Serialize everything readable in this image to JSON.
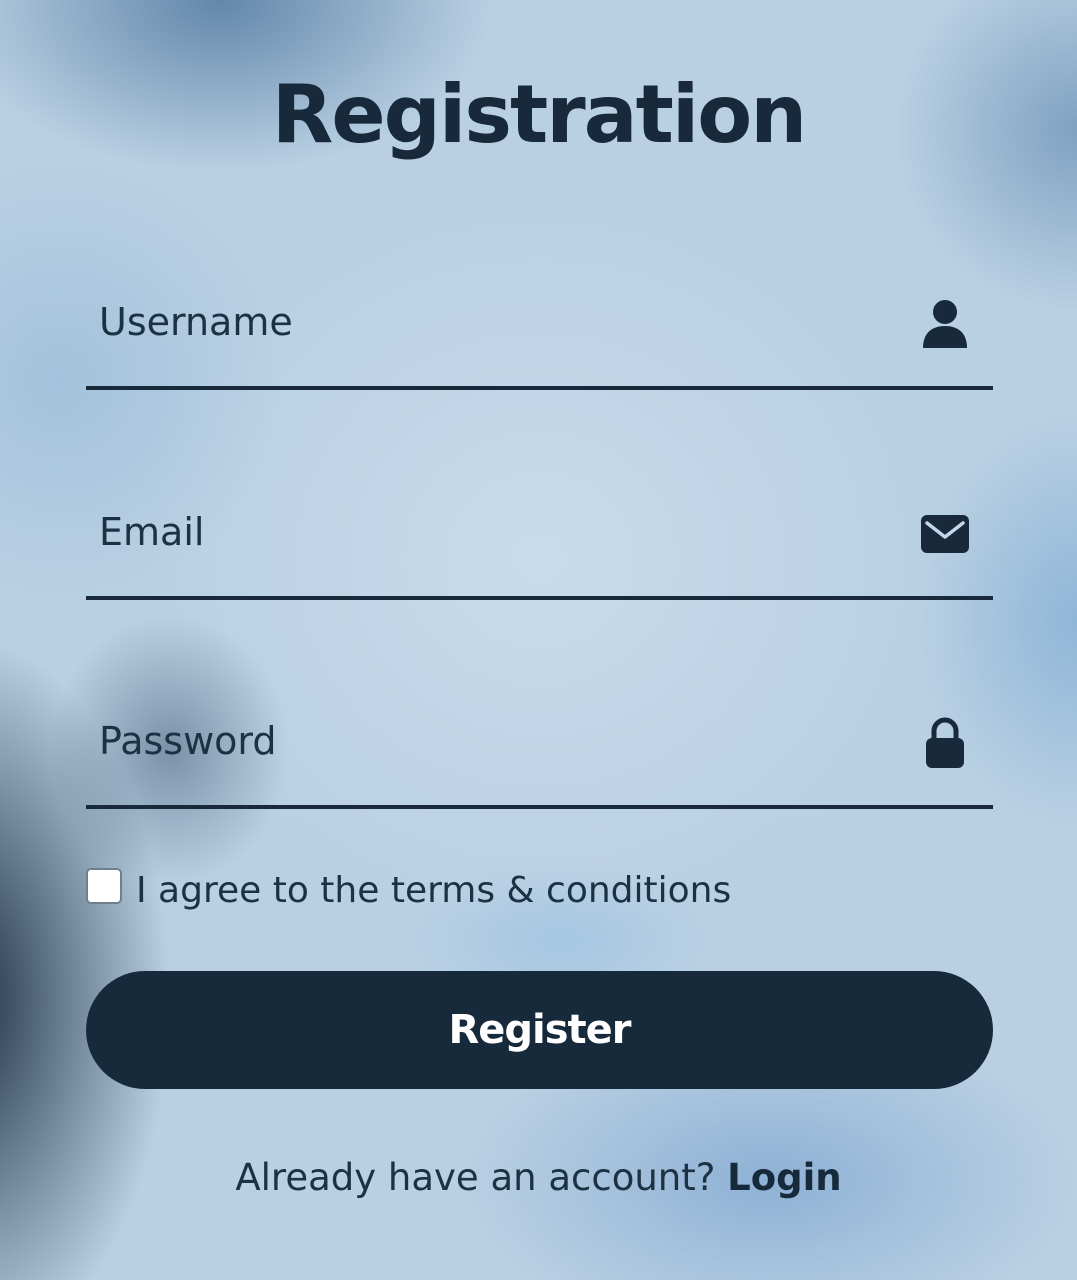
{
  "form": {
    "title": "Registration",
    "fields": {
      "username": {
        "placeholder": "Username",
        "value": "",
        "icon": "user-icon"
      },
      "email": {
        "placeholder": "Email",
        "value": "",
        "icon": "envelope-icon"
      },
      "password": {
        "placeholder": "Password",
        "value": "",
        "icon": "lock-icon"
      }
    },
    "terms": {
      "label": "I agree to the terms & conditions",
      "checked": false
    },
    "register_label": "Register",
    "login_prompt": "Already have an account?",
    "login_link_label": "Login"
  },
  "colors": {
    "primary": "#162a3b",
    "background": "#c3d8ea",
    "button_text": "#ffffff"
  }
}
